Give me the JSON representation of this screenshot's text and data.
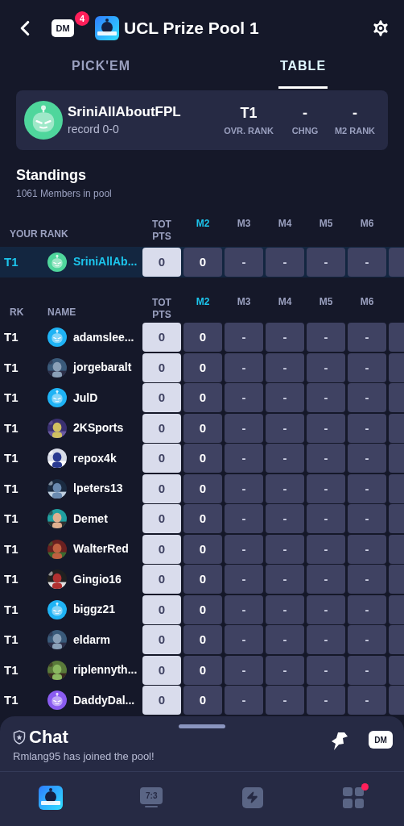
{
  "header": {
    "title": "UCL Prize Pool 1",
    "dm_label": "DM",
    "dm_badge": "4"
  },
  "tabs": [
    {
      "label": "PICK'EM",
      "selected": false
    },
    {
      "label": "TABLE",
      "selected": true
    }
  ],
  "profile": {
    "name": "SriniAllAboutFPL",
    "record": "record 0-0",
    "avatar": {
      "kind": "robot",
      "color": "#4fd69c"
    },
    "stats": [
      {
        "value": "T1",
        "label": "OVR. RANK"
      },
      {
        "value": "-",
        "label": "CHNG"
      },
      {
        "value": "-",
        "label": "M2 RANK"
      }
    ]
  },
  "standings": {
    "title": "Standings",
    "subtitle": "1061 Members in pool"
  },
  "your_rank": {
    "heading": "YOUR RANK",
    "columns": [
      {
        "label": "TOT PTS",
        "current": false
      },
      {
        "label": "M2",
        "current": true
      },
      {
        "label": "M3",
        "current": false
      },
      {
        "label": "M4",
        "current": false
      },
      {
        "label": "M5",
        "current": false
      },
      {
        "label": "M6",
        "current": false
      }
    ],
    "row": {
      "rank": "T1",
      "name": "SriniAllAb...",
      "avatar": {
        "kind": "robot",
        "color": "#4fd69c"
      },
      "cells": [
        "0",
        "0",
        "-",
        "-",
        "-",
        "-"
      ]
    }
  },
  "table": {
    "rank_heading": "RK",
    "name_heading": "NAME",
    "columns": [
      {
        "label": "TOT PTS",
        "current": false
      },
      {
        "label": "M2",
        "current": true
      },
      {
        "label": "M3",
        "current": false
      },
      {
        "label": "M4",
        "current": false
      },
      {
        "label": "M5",
        "current": false
      },
      {
        "label": "M6",
        "current": false
      }
    ],
    "rows": [
      {
        "rank": "T1",
        "name": "adamslee...",
        "avatar": {
          "kind": "robot",
          "color": "#1fb3f5"
        },
        "cells": [
          "0",
          "0",
          "-",
          "-",
          "-",
          "-"
        ]
      },
      {
        "rank": "T1",
        "name": "jorgebaralt",
        "cells": [
          "0",
          "0",
          "-",
          "-",
          "-",
          "-"
        ]
      },
      {
        "rank": "T1",
        "name": "JulD",
        "avatar": {
          "kind": "robot",
          "color": "#1fb3f5"
        },
        "cells": [
          "0",
          "0",
          "-",
          "-",
          "-",
          "-"
        ]
      },
      {
        "rank": "T1",
        "name": "2KSports",
        "cells": [
          "0",
          "0",
          "-",
          "-",
          "-",
          "-"
        ]
      },
      {
        "rank": "T1",
        "name": "repox4k",
        "cells": [
          "0",
          "0",
          "-",
          "-",
          "-",
          "-"
        ]
      },
      {
        "rank": "T1",
        "name": "lpeters13",
        "cells": [
          "0",
          "0",
          "-",
          "-",
          "-",
          "-"
        ]
      },
      {
        "rank": "T1",
        "name": "Demet",
        "cells": [
          "0",
          "0",
          "-",
          "-",
          "-",
          "-"
        ]
      },
      {
        "rank": "T1",
        "name": "WalterRed",
        "cells": [
          "0",
          "0",
          "-",
          "-",
          "-",
          "-"
        ]
      },
      {
        "rank": "T1",
        "name": "Gingio16",
        "cells": [
          "0",
          "0",
          "-",
          "-",
          "-",
          "-"
        ]
      },
      {
        "rank": "T1",
        "name": "biggz21",
        "avatar": {
          "kind": "robot",
          "color": "#1fb3f5"
        },
        "cells": [
          "0",
          "0",
          "-",
          "-",
          "-",
          "-"
        ]
      },
      {
        "rank": "T1",
        "name": "eldarm",
        "cells": [
          "0",
          "0",
          "-",
          "-",
          "-",
          "-"
        ]
      },
      {
        "rank": "T1",
        "name": "riplennyth...",
        "cells": [
          "0",
          "0",
          "-",
          "-",
          "-",
          "-"
        ]
      },
      {
        "rank": "T1",
        "name": "DaddyDal...",
        "avatar": {
          "kind": "robot",
          "color": "#8a5cf0"
        },
        "cells": [
          "0",
          "0",
          "-",
          "-",
          "-",
          "-"
        ]
      }
    ]
  },
  "chat": {
    "title": "Chat",
    "message": "Rmlang95 has joined the pool!",
    "dm_label": "DM"
  },
  "nav": [
    {
      "kind": "logo",
      "selected": true
    },
    {
      "kind": "score",
      "label": "7:3",
      "selected": false
    },
    {
      "kind": "bolt",
      "selected": false
    },
    {
      "kind": "grid",
      "selected": false,
      "badge": true
    }
  ]
}
